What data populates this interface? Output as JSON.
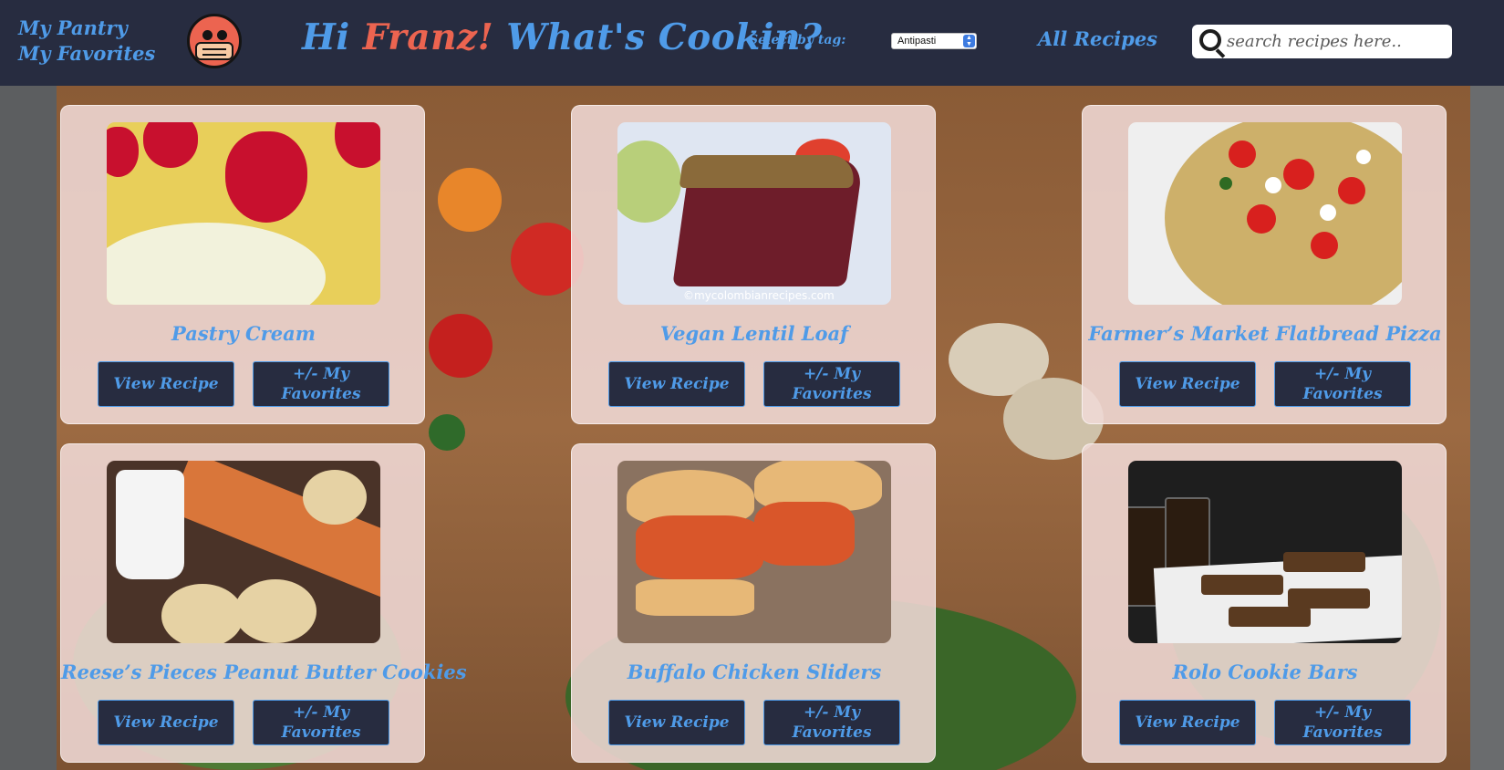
{
  "header": {
    "links": [
      "My Pantry",
      "My Favorites"
    ],
    "greeting_prefix": "Hi ",
    "user_name": "Franz!",
    "greeting_suffix": " What's Cookin?",
    "tag_label": "Select by tag:",
    "tag_selected": "Antipasti",
    "all_recipes": "All Recipes",
    "search_placeholder": "search recipes here.."
  },
  "colors": {
    "header_bg": "#272c40",
    "accent_blue": "#4f9be8",
    "accent_red": "#ec6450",
    "card_bg": "#f0dad6"
  },
  "recipes": [
    {
      "title": "Pastry Cream",
      "view_label": "View Recipe",
      "fav_label": "+/- My Favorites"
    },
    {
      "title": "Vegan Lentil Loaf",
      "view_label": "View Recipe",
      "fav_label": "+/- My Favorites",
      "photo_watermark": "©mycolombianrecipes.com"
    },
    {
      "title": "Farmer’s Market Flatbread Pizza",
      "view_label": "View Recipe",
      "fav_label": "+/- My Favorites"
    },
    {
      "title": "Reese’s Pieces Peanut Butter Cookies",
      "view_label": "View Recipe",
      "fav_label": "+/- My Favorites"
    },
    {
      "title": "Buffalo Chicken Sliders",
      "view_label": "View Recipe",
      "fav_label": "+/- My Favorites"
    },
    {
      "title": "Rolo Cookie Bars",
      "view_label": "View Recipe",
      "fav_label": "+/- My Favorites"
    }
  ]
}
